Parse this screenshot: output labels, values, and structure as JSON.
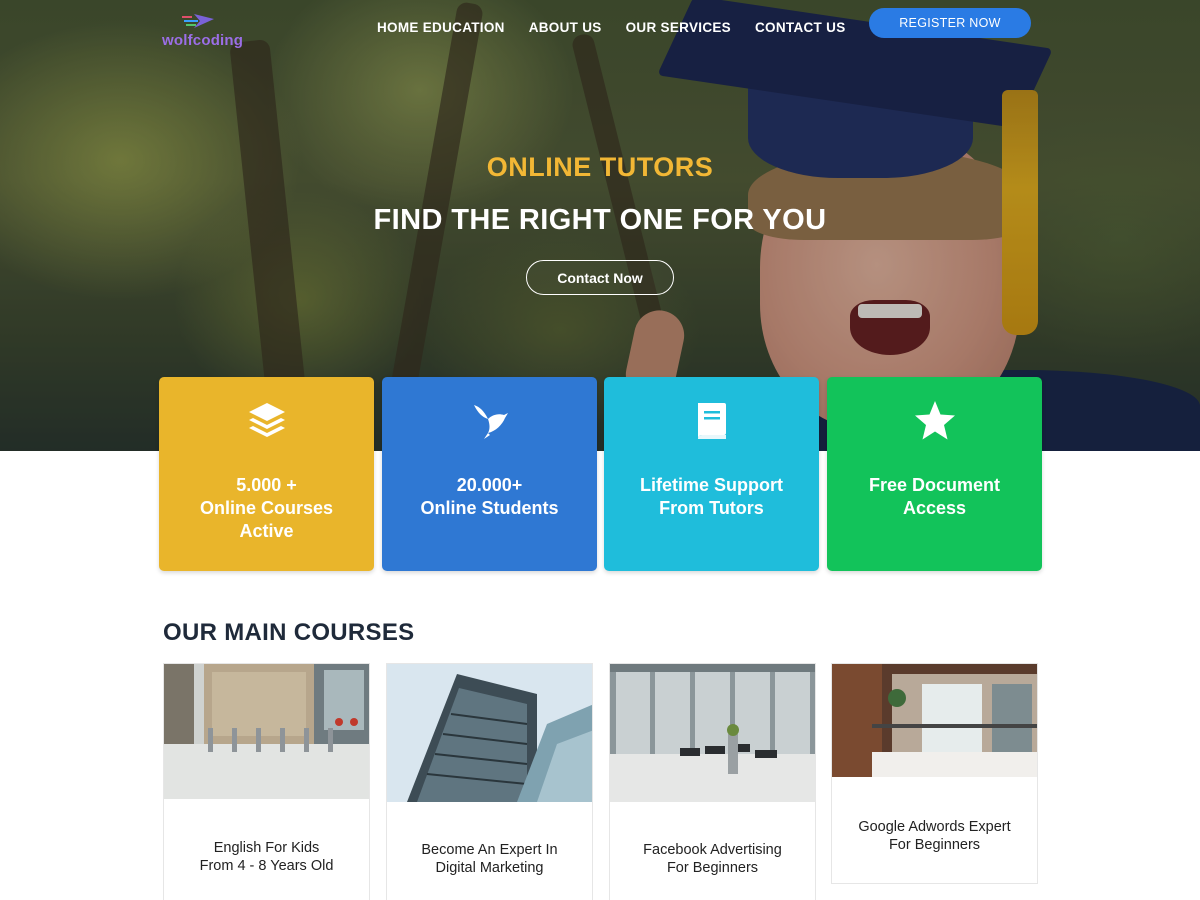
{
  "logo": {
    "text": "wolfcoding",
    "icon": "logo-bird-icon"
  },
  "nav": {
    "items": [
      {
        "label": "HOME EDUCATION"
      },
      {
        "label": "ABOUT US"
      },
      {
        "label": "OUR SERVICES"
      },
      {
        "label": "CONTACT US"
      }
    ],
    "register_label": "REGISTER NOW"
  },
  "hero": {
    "subtitle": "ONLINE TUTORS",
    "title": "FIND THE RIGHT ONE FOR YOU",
    "cta_label": "Contact Now"
  },
  "features": [
    {
      "label": "5.000 +\nOnline Courses\nActive",
      "icon": "layers-icon",
      "color": "#e9b52b"
    },
    {
      "label": "20.000+\nOnline Students",
      "icon": "bird-icon",
      "color": "#2f78d3"
    },
    {
      "label": "Lifetime Support\nFrom Tutors",
      "icon": "book-icon",
      "color": "#1fbddb"
    },
    {
      "label": "Free Document\nAccess",
      "icon": "star-icon",
      "color": "#12c35a"
    }
  ],
  "courses_section": {
    "title": "OUR MAIN COURSES",
    "items": [
      {
        "name": "English For Kids\nFrom 4 - 8 Years Old"
      },
      {
        "name": "Become An Expert In\nDigital Marketing"
      },
      {
        "name": "Facebook Advertising\nFor Beginners"
      },
      {
        "name": "Google Adwords Expert\nFor Beginners"
      }
    ]
  },
  "colors": {
    "accent_blue": "#2a7be4",
    "hero_subtitle": "#f2b735",
    "heading": "#1f2a3a"
  }
}
